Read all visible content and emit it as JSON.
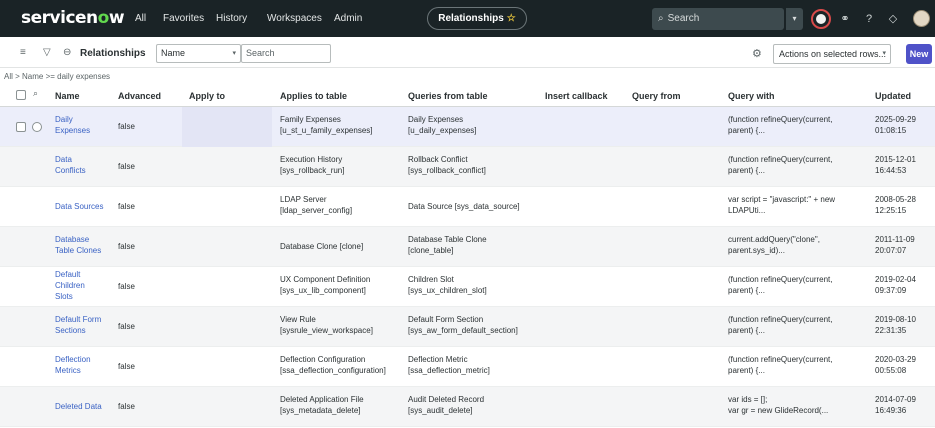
{
  "nav": {
    "logo_main": "servicen",
    "logo_o": "o",
    "logo_end": "w",
    "items": [
      "All",
      "Favorites",
      "History",
      "Workspaces",
      "Admin"
    ],
    "context_pill": "Relationships",
    "pill_star": "☆",
    "search_placeholder": "Search",
    "search_caret": "▾",
    "icons": {
      "globe": "⊕",
      "sparkle": "⚭",
      "help": "?",
      "bell": "◇"
    }
  },
  "toolbar": {
    "menu_icon": "≡",
    "filter_icon": "▽",
    "link_icon": "⊖",
    "title": "Relationships",
    "field_select": "Name",
    "field_caret": "▾",
    "search_placeholder": "Search",
    "settings_icon": "⚙",
    "actions_select": "Actions on selected rows...",
    "actions_caret": "▾",
    "new_label": "New"
  },
  "breadcrumb": "All > Name >= daily expenses",
  "table": {
    "search_icon": "⌕",
    "columns": [
      "Name",
      "Advanced",
      "Apply to",
      "Applies to table",
      "Queries from table",
      "Insert callback",
      "Query from",
      "Query with",
      "Updated"
    ],
    "rows": [
      {
        "name_1": "Daily",
        "name_2": "Expenses",
        "name_3": "",
        "advanced": "false",
        "applies_1": "Family Expenses",
        "applies_2": "[u_st_u_family_expenses]",
        "queries_1": "Daily Expenses",
        "queries_2": "[u_daily_expenses]",
        "with_1": "(function refineQuery(current,",
        "with_2": "parent) {...",
        "updated_1": "2025-09-29",
        "updated_2": "01:08:15"
      },
      {
        "name_1": "Data",
        "name_2": "Conflicts",
        "name_3": "",
        "advanced": "false",
        "applies_1": "Execution History",
        "applies_2": "[sys_rollback_run]",
        "queries_1": "Rollback Conflict",
        "queries_2": "[sys_rollback_conflict]",
        "with_1": "(function refineQuery(current,",
        "with_2": "parent) {...",
        "updated_1": "2015-12-01",
        "updated_2": "16:44:53"
      },
      {
        "name_1": "Data Sources",
        "name_2": "",
        "name_3": "",
        "advanced": "false",
        "applies_1": "LDAP Server",
        "applies_2": "[ldap_server_config]",
        "queries_1": "Data Source [sys_data_source]",
        "queries_2": "",
        "with_1": "var script = \"javascript:\" + new",
        "with_2": "LDAPUti...",
        "updated_1": "2008-05-28",
        "updated_2": "12:25:15"
      },
      {
        "name_1": "Database",
        "name_2": "Table Clones",
        "name_3": "",
        "advanced": "false",
        "applies_1": "Database Clone [clone]",
        "applies_2": "",
        "queries_1": "Database Table Clone",
        "queries_2": "[clone_table]",
        "with_1": "current.addQuery(\"clone\",",
        "with_2": "parent.sys_id)...",
        "updated_1": "2011-11-09",
        "updated_2": "20:07:07"
      },
      {
        "name_1": "Default",
        "name_2": "Children",
        "name_3": "Slots",
        "advanced": "false",
        "applies_1": "UX Component Definition",
        "applies_2": "[sys_ux_lib_component]",
        "queries_1": "Children Slot",
        "queries_2": "[sys_ux_children_slot]",
        "with_1": "(function refineQuery(current,",
        "with_2": "parent) {...",
        "updated_1": "2019-02-04",
        "updated_2": "09:37:09"
      },
      {
        "name_1": "Default Form",
        "name_2": "Sections",
        "name_3": "",
        "advanced": "false",
        "applies_1": "View Rule",
        "applies_2": "[sysrule_view_workspace]",
        "queries_1": "Default Form Section",
        "queries_2": "[sys_aw_form_default_section]",
        "with_1": "(function refineQuery(current,",
        "with_2": "parent) {...",
        "updated_1": "2019-08-10",
        "updated_2": "22:31:35"
      },
      {
        "name_1": "Deflection",
        "name_2": "Metrics",
        "name_3": "",
        "advanced": "false",
        "applies_1": "Deflection Configuration",
        "applies_2": "[ssa_deflection_configuration]",
        "queries_1": "Deflection Metric",
        "queries_2": "[ssa_deflection_metric]",
        "with_1": "(function refineQuery(current,",
        "with_2": "parent) {...",
        "updated_1": "2020-03-29",
        "updated_2": "00:55:08"
      },
      {
        "name_1": "Deleted Data",
        "name_2": "",
        "name_3": "",
        "advanced": "false",
        "applies_1": "Deleted Application File",
        "applies_2": "[sys_metadata_delete]",
        "queries_1": "Audit Deleted Record",
        "queries_2": "[sys_audit_delete]",
        "with_1": "var ids = [];",
        "with_2": "var gr = new GlideRecord(...",
        "updated_1": "2014-07-09",
        "updated_2": "16:49:36"
      }
    ]
  }
}
